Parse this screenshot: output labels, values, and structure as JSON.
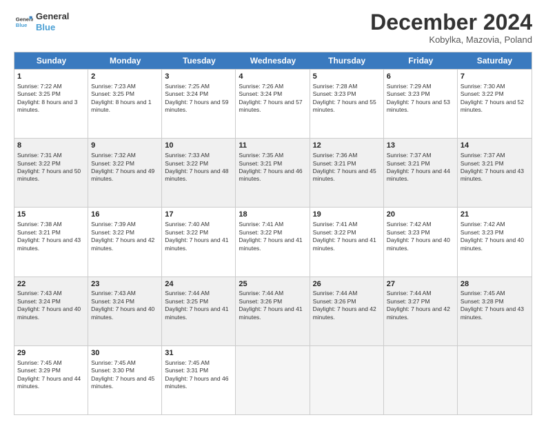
{
  "logo": {
    "line1": "General",
    "line2": "Blue"
  },
  "header": {
    "month": "December 2024",
    "location": "Kobylka, Mazovia, Poland"
  },
  "weekdays": [
    "Sunday",
    "Monday",
    "Tuesday",
    "Wednesday",
    "Thursday",
    "Friday",
    "Saturday"
  ],
  "weeks": [
    [
      {
        "day": "1",
        "sunrise": "Sunrise: 7:22 AM",
        "sunset": "Sunset: 3:25 PM",
        "daylight": "Daylight: 8 hours and 3 minutes.",
        "empty": false,
        "shaded": false
      },
      {
        "day": "2",
        "sunrise": "Sunrise: 7:23 AM",
        "sunset": "Sunset: 3:25 PM",
        "daylight": "Daylight: 8 hours and 1 minute.",
        "empty": false,
        "shaded": false
      },
      {
        "day": "3",
        "sunrise": "Sunrise: 7:25 AM",
        "sunset": "Sunset: 3:24 PM",
        "daylight": "Daylight: 7 hours and 59 minutes.",
        "empty": false,
        "shaded": false
      },
      {
        "day": "4",
        "sunrise": "Sunrise: 7:26 AM",
        "sunset": "Sunset: 3:24 PM",
        "daylight": "Daylight: 7 hours and 57 minutes.",
        "empty": false,
        "shaded": false
      },
      {
        "day": "5",
        "sunrise": "Sunrise: 7:28 AM",
        "sunset": "Sunset: 3:23 PM",
        "daylight": "Daylight: 7 hours and 55 minutes.",
        "empty": false,
        "shaded": false
      },
      {
        "day": "6",
        "sunrise": "Sunrise: 7:29 AM",
        "sunset": "Sunset: 3:23 PM",
        "daylight": "Daylight: 7 hours and 53 minutes.",
        "empty": false,
        "shaded": false
      },
      {
        "day": "7",
        "sunrise": "Sunrise: 7:30 AM",
        "sunset": "Sunset: 3:22 PM",
        "daylight": "Daylight: 7 hours and 52 minutes.",
        "empty": false,
        "shaded": false
      }
    ],
    [
      {
        "day": "8",
        "sunrise": "Sunrise: 7:31 AM",
        "sunset": "Sunset: 3:22 PM",
        "daylight": "Daylight: 7 hours and 50 minutes.",
        "empty": false,
        "shaded": true
      },
      {
        "day": "9",
        "sunrise": "Sunrise: 7:32 AM",
        "sunset": "Sunset: 3:22 PM",
        "daylight": "Daylight: 7 hours and 49 minutes.",
        "empty": false,
        "shaded": true
      },
      {
        "day": "10",
        "sunrise": "Sunrise: 7:33 AM",
        "sunset": "Sunset: 3:22 PM",
        "daylight": "Daylight: 7 hours and 48 minutes.",
        "empty": false,
        "shaded": true
      },
      {
        "day": "11",
        "sunrise": "Sunrise: 7:35 AM",
        "sunset": "Sunset: 3:21 PM",
        "daylight": "Daylight: 7 hours and 46 minutes.",
        "empty": false,
        "shaded": true
      },
      {
        "day": "12",
        "sunrise": "Sunrise: 7:36 AM",
        "sunset": "Sunset: 3:21 PM",
        "daylight": "Daylight: 7 hours and 45 minutes.",
        "empty": false,
        "shaded": true
      },
      {
        "day": "13",
        "sunrise": "Sunrise: 7:37 AM",
        "sunset": "Sunset: 3:21 PM",
        "daylight": "Daylight: 7 hours and 44 minutes.",
        "empty": false,
        "shaded": true
      },
      {
        "day": "14",
        "sunrise": "Sunrise: 7:37 AM",
        "sunset": "Sunset: 3:21 PM",
        "daylight": "Daylight: 7 hours and 43 minutes.",
        "empty": false,
        "shaded": true
      }
    ],
    [
      {
        "day": "15",
        "sunrise": "Sunrise: 7:38 AM",
        "sunset": "Sunset: 3:21 PM",
        "daylight": "Daylight: 7 hours and 43 minutes.",
        "empty": false,
        "shaded": false
      },
      {
        "day": "16",
        "sunrise": "Sunrise: 7:39 AM",
        "sunset": "Sunset: 3:22 PM",
        "daylight": "Daylight: 7 hours and 42 minutes.",
        "empty": false,
        "shaded": false
      },
      {
        "day": "17",
        "sunrise": "Sunrise: 7:40 AM",
        "sunset": "Sunset: 3:22 PM",
        "daylight": "Daylight: 7 hours and 41 minutes.",
        "empty": false,
        "shaded": false
      },
      {
        "day": "18",
        "sunrise": "Sunrise: 7:41 AM",
        "sunset": "Sunset: 3:22 PM",
        "daylight": "Daylight: 7 hours and 41 minutes.",
        "empty": false,
        "shaded": false
      },
      {
        "day": "19",
        "sunrise": "Sunrise: 7:41 AM",
        "sunset": "Sunset: 3:22 PM",
        "daylight": "Daylight: 7 hours and 41 minutes.",
        "empty": false,
        "shaded": false
      },
      {
        "day": "20",
        "sunrise": "Sunrise: 7:42 AM",
        "sunset": "Sunset: 3:23 PM",
        "daylight": "Daylight: 7 hours and 40 minutes.",
        "empty": false,
        "shaded": false
      },
      {
        "day": "21",
        "sunrise": "Sunrise: 7:42 AM",
        "sunset": "Sunset: 3:23 PM",
        "daylight": "Daylight: 7 hours and 40 minutes.",
        "empty": false,
        "shaded": false
      }
    ],
    [
      {
        "day": "22",
        "sunrise": "Sunrise: 7:43 AM",
        "sunset": "Sunset: 3:24 PM",
        "daylight": "Daylight: 7 hours and 40 minutes.",
        "empty": false,
        "shaded": true
      },
      {
        "day": "23",
        "sunrise": "Sunrise: 7:43 AM",
        "sunset": "Sunset: 3:24 PM",
        "daylight": "Daylight: 7 hours and 40 minutes.",
        "empty": false,
        "shaded": true
      },
      {
        "day": "24",
        "sunrise": "Sunrise: 7:44 AM",
        "sunset": "Sunset: 3:25 PM",
        "daylight": "Daylight: 7 hours and 41 minutes.",
        "empty": false,
        "shaded": true
      },
      {
        "day": "25",
        "sunrise": "Sunrise: 7:44 AM",
        "sunset": "Sunset: 3:26 PM",
        "daylight": "Daylight: 7 hours and 41 minutes.",
        "empty": false,
        "shaded": true
      },
      {
        "day": "26",
        "sunrise": "Sunrise: 7:44 AM",
        "sunset": "Sunset: 3:26 PM",
        "daylight": "Daylight: 7 hours and 42 minutes.",
        "empty": false,
        "shaded": true
      },
      {
        "day": "27",
        "sunrise": "Sunrise: 7:44 AM",
        "sunset": "Sunset: 3:27 PM",
        "daylight": "Daylight: 7 hours and 42 minutes.",
        "empty": false,
        "shaded": true
      },
      {
        "day": "28",
        "sunrise": "Sunrise: 7:45 AM",
        "sunset": "Sunset: 3:28 PM",
        "daylight": "Daylight: 7 hours and 43 minutes.",
        "empty": false,
        "shaded": true
      }
    ],
    [
      {
        "day": "29",
        "sunrise": "Sunrise: 7:45 AM",
        "sunset": "Sunset: 3:29 PM",
        "daylight": "Daylight: 7 hours and 44 minutes.",
        "empty": false,
        "shaded": false
      },
      {
        "day": "30",
        "sunrise": "Sunrise: 7:45 AM",
        "sunset": "Sunset: 3:30 PM",
        "daylight": "Daylight: 7 hours and 45 minutes.",
        "empty": false,
        "shaded": false
      },
      {
        "day": "31",
        "sunrise": "Sunrise: 7:45 AM",
        "sunset": "Sunset: 3:31 PM",
        "daylight": "Daylight: 7 hours and 46 minutes.",
        "empty": false,
        "shaded": false
      },
      {
        "day": "",
        "sunrise": "",
        "sunset": "",
        "daylight": "",
        "empty": true,
        "shaded": false
      },
      {
        "day": "",
        "sunrise": "",
        "sunset": "",
        "daylight": "",
        "empty": true,
        "shaded": false
      },
      {
        "day": "",
        "sunrise": "",
        "sunset": "",
        "daylight": "",
        "empty": true,
        "shaded": false
      },
      {
        "day": "",
        "sunrise": "",
        "sunset": "",
        "daylight": "",
        "empty": true,
        "shaded": false
      }
    ]
  ]
}
